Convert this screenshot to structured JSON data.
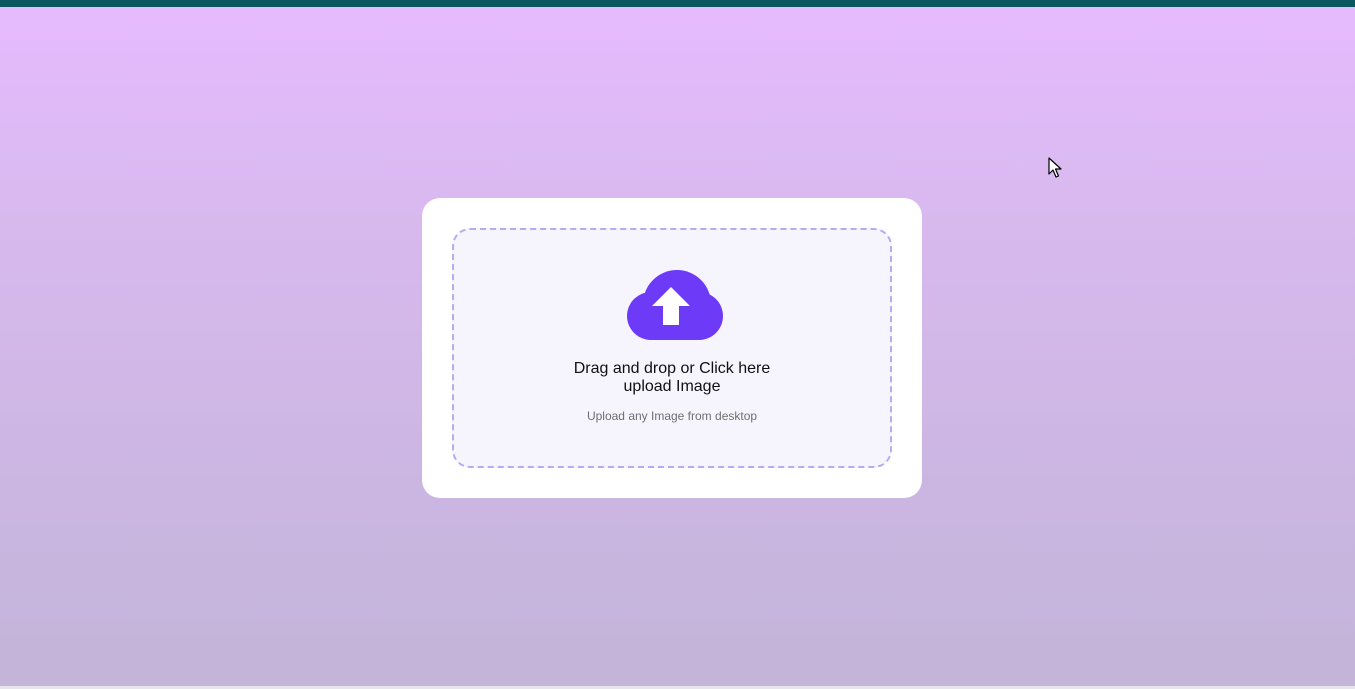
{
  "colors": {
    "top_bar": "#0d5860",
    "accent": "#6d3af7",
    "dropzone_border": "#b7abf2",
    "dropzone_bg": "#f6f5fd"
  },
  "upload": {
    "icon": "cloud-upload-icon",
    "title_line1": "Drag and drop or Click here",
    "title_line2": "upload Image",
    "subtitle": "Upload any Image from desktop"
  },
  "cursor": {
    "icon": "mouse-pointer-icon"
  }
}
